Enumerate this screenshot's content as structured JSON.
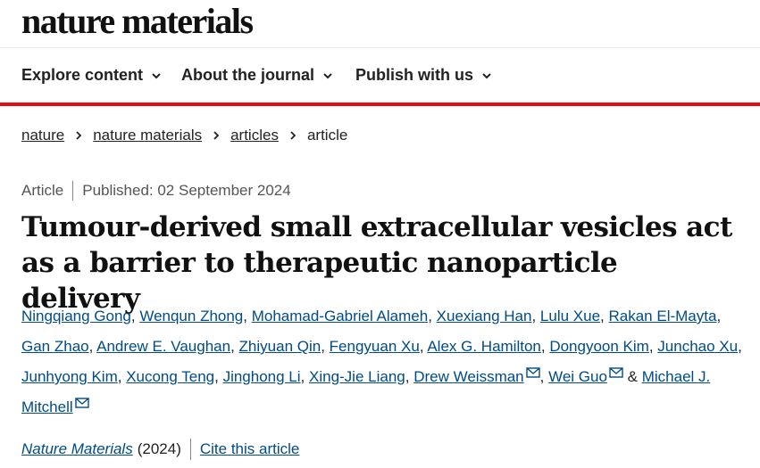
{
  "site": {
    "logo": "nature materials"
  },
  "nav": {
    "items": [
      {
        "label": "Explore content"
      },
      {
        "label": "About the journal"
      },
      {
        "label": "Publish with us"
      }
    ]
  },
  "breadcrumb": {
    "items": [
      "nature",
      "nature materials",
      "articles"
    ],
    "current": "article"
  },
  "article": {
    "type": "Article",
    "published": "Published: 02 September 2024",
    "title": "Tumour-derived small extracellular vesicles act as a barrier to therapeutic nanoparticle delivery",
    "authors": [
      "Ningqiang Gong",
      "Wenqun Zhong",
      "Mohamad-Gabriel Alameh",
      "Xuexiang Han",
      "Lulu Xue",
      "Rakan El-Mayta",
      "Gan Zhao",
      "Andrew E. Vaughan",
      "Zhiyuan Qin",
      "Fengyuan Xu",
      "Alex G. Hamilton",
      "Dongyoon Kim",
      "Junchao Xu",
      "Junhyong Kim",
      "Xucong Teng",
      "Jinghong Li",
      "Xing-Jie Liang",
      "Drew Weissman",
      "Wei Guo",
      "Michael J. Mitchell"
    ],
    "and": "&",
    "journal": "Nature Materials",
    "year": "(2024)",
    "cite_label": "Cite this article"
  },
  "colors": {
    "accent_red": "#e30b17",
    "link_blue": "#004b83"
  },
  "icons": [
    "chevron-down-icon",
    "chevron-right-icon",
    "mail-icon"
  ]
}
